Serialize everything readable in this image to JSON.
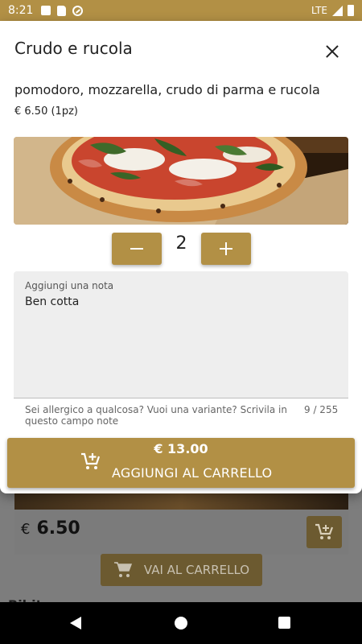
{
  "status_bar": {
    "time": "8:21",
    "network": "LTE"
  },
  "dialog": {
    "title": "Crudo e rucola",
    "description": "pomodoro, mozzarella, crudo di parma e rucola",
    "unit_price": "€ 6.50 (1pz)",
    "quantity": "2",
    "note": {
      "label": "Aggiungi una nota",
      "value": "Ben cotta",
      "hint": "Sei allergico a qualcosa? Vuoi una variante? Scrivila in questo campo note",
      "counter": "9 / 255"
    },
    "add_button": {
      "total": "€ 13.00",
      "label": "AGGIUNGI AL CARRELLO"
    }
  },
  "background": {
    "price_currency": "€",
    "price_value": "6.50",
    "go_to_cart": "VAI AL CARRELLO",
    "next_section": "Bibite"
  },
  "colors": {
    "accent": "#b29045"
  }
}
